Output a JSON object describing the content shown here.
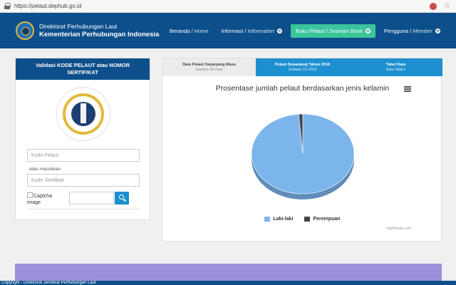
{
  "browser": {
    "url": "https://pelaut.dephub.go.id"
  },
  "header": {
    "brand_line1": "Direktorat Perhubungan Laut",
    "brand_line2": "Kementerian Perhubungan Indonesia",
    "nav": [
      {
        "label": "Beranda /",
        "sub": "Home",
        "has_dropdown": false
      },
      {
        "label": "Informasi /",
        "sub": "Information",
        "has_dropdown": true
      },
      {
        "label": "Buku Pelaut /",
        "sub": "Seaman Book",
        "has_dropdown": true
      },
      {
        "label": "Pengguna /",
        "sub": "Member",
        "has_dropdown": true
      }
    ]
  },
  "validation": {
    "title": "Validasi KODE PELAUT atau NOMOR SERTIFIKAT",
    "code_placeholder": "Kode Pelaut",
    "or_text": "atau masukkan",
    "cert_placeholder": "Kode Sertifikat",
    "captcha_alt": "Captcha image"
  },
  "tabs": [
    {
      "label": "Data Pelaut Sepanjang Masa",
      "sub": "Seafarer All Data",
      "active": true
    },
    {
      "label": "Pelaut Sepanjang Tahun 2016",
      "sub": "Seafarer On 2016",
      "active": false
    },
    {
      "label": "Tabel Data",
      "sub": "Data Table's",
      "active": false
    }
  ],
  "chart_data": {
    "type": "pie",
    "title": "Prosentase jumlah pelaut berdasarkan jenis kelamin",
    "slices": [
      {
        "name": "Laki-laki",
        "value": 98.7,
        "color": "#7cb5ec"
      },
      {
        "name": "Perempuan",
        "value": 1.3,
        "color": "#434348"
      }
    ],
    "legend_position": "bottom",
    "credits": "Highcharts.com"
  },
  "footer": {
    "text": "Copyright - Direktorat Jenderal Perhubungan Laut"
  },
  "colors": {
    "primary": "#0d4f8b",
    "accent": "#1e8fcf",
    "active_nav": "#3cc49b",
    "band": "#9c8fd9"
  }
}
